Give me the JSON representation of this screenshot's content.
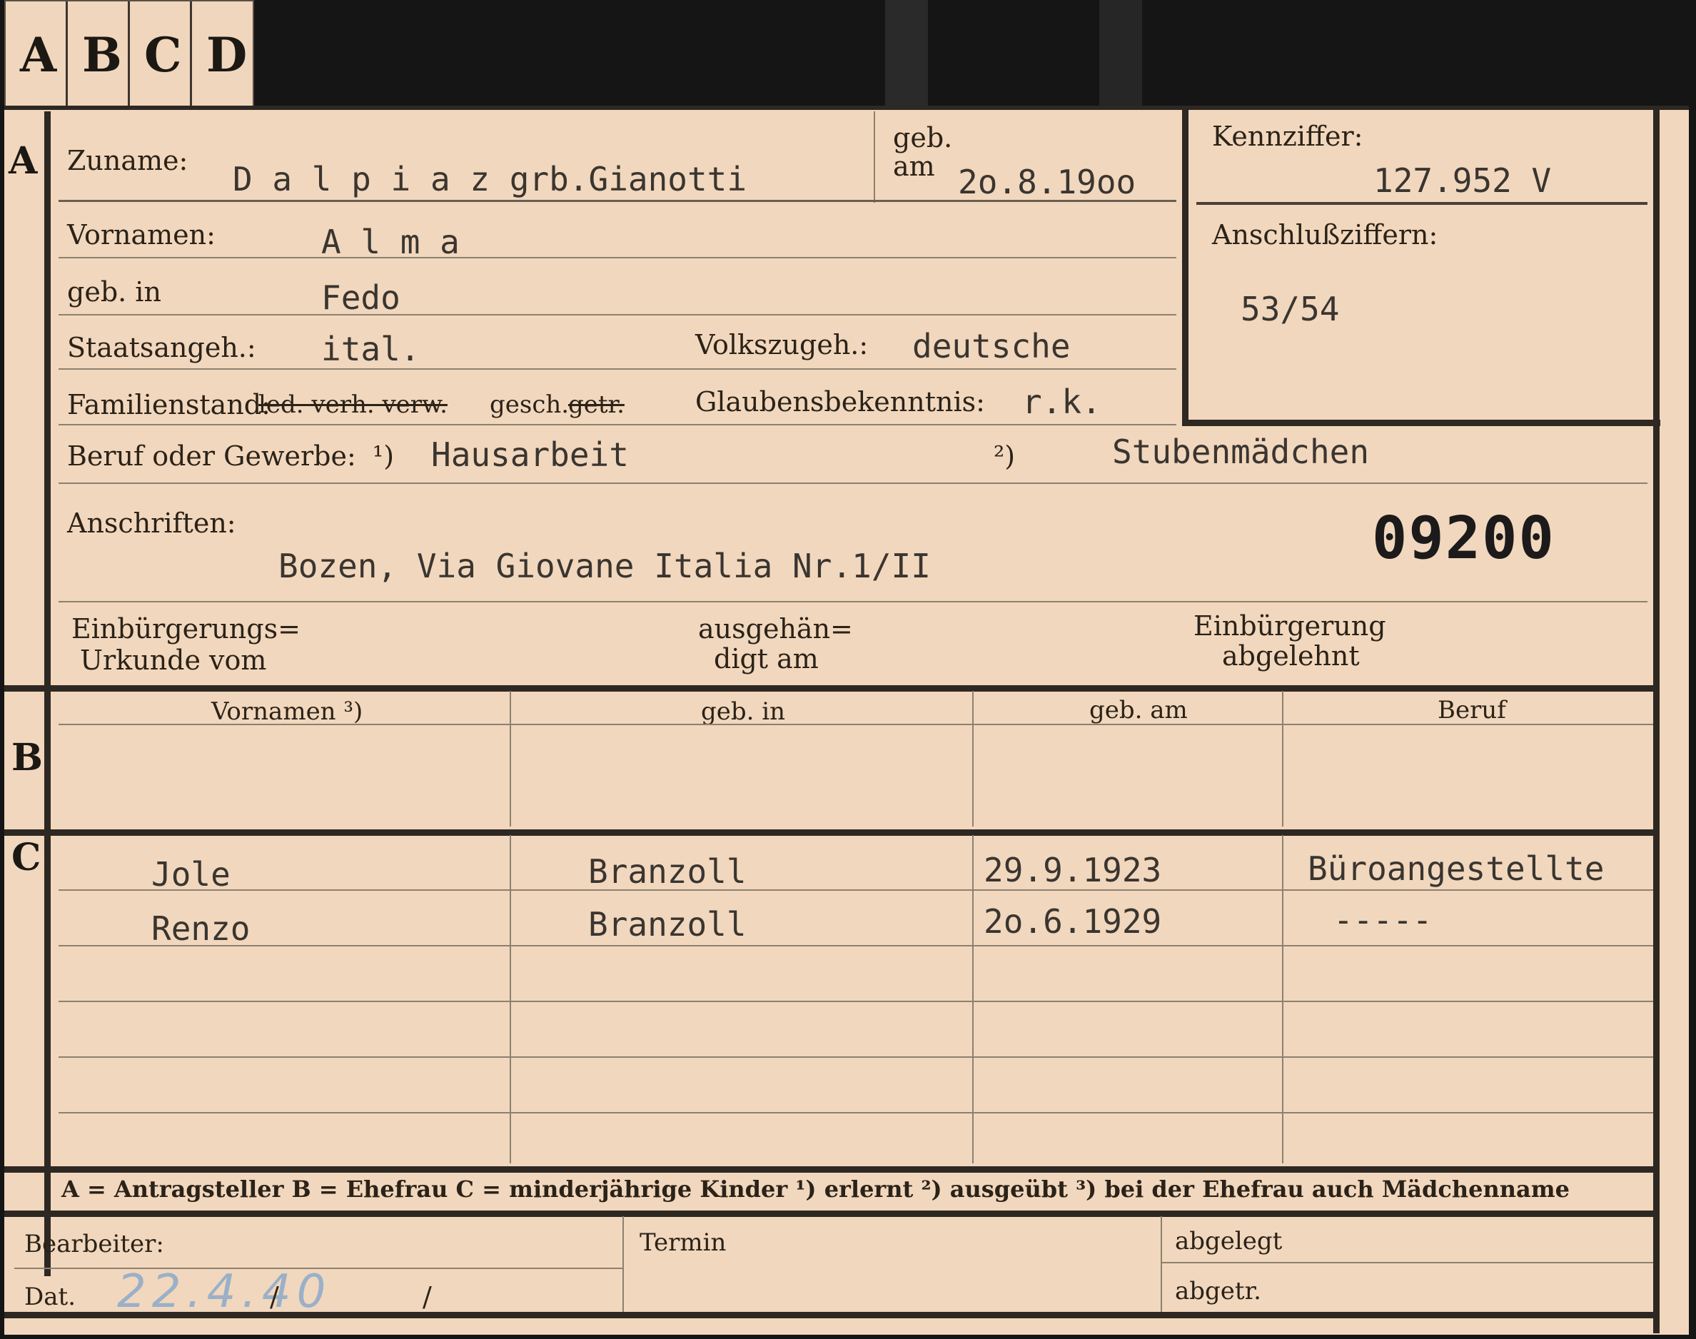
{
  "tabs": [
    "A",
    "B",
    "C",
    "D"
  ],
  "section_a": {
    "letter": "A",
    "zuname_label": "Zuname:",
    "zuname_value": "D a l p i a z   grb.Gianotti",
    "geb_am_label_1": "geb.",
    "geb_am_label_2": "am",
    "geb_am_value": "2o.8.19oo",
    "kennziffer_label": "Kennziffer:",
    "kennziffer_value": "127.952  V",
    "anschluss_label": "Anschlußziffern:",
    "anschluss_value": "53/54",
    "vornamen_label": "Vornamen:",
    "vornamen_value": "A l m a",
    "geb_in_label": "geb. in",
    "geb_in_value": "Fedo",
    "staatsangeh_label": "Staatsangeh.:",
    "staatsangeh_value": "ital.",
    "volkszugeh_label": "Volkszugeh.:",
    "volkszugeh_value": "deutsche",
    "familienstand_label": "Familienstand:",
    "familienstand_struck": "led. verh. verw.",
    "familienstand_kept": "gesch.",
    "familienstand_struck2": "getr.",
    "glaubens_label": "Glaubensbekenntnis:",
    "glaubens_value": "r.k.",
    "beruf_label": "Beruf oder Gewerbe:",
    "beruf_mark1": "¹)",
    "beruf_value1": "Hausarbeit",
    "beruf_mark2": "²)",
    "beruf_value2": "Stubenmädchen",
    "anschriften_label": "Anschriften:",
    "anschriften_value": "Bozen, Via Giovane Italia Nr.1/II",
    "stamp_number": "09200",
    "einb_urkunde_1": "Einbürgerungs=",
    "einb_urkunde_2": "Urkunde vom",
    "ausgehaendigt_1": "ausgehän=",
    "ausgehaendigt_2": "digt am",
    "einb_abgelehnt_1": "Einbürgerung",
    "einb_abgelehnt_2": "abgelehnt"
  },
  "section_b": {
    "letter": "B",
    "headers": [
      "Vornamen ³)",
      "geb. in",
      "geb. am",
      "Beruf"
    ]
  },
  "section_c": {
    "letter": "C",
    "rows": [
      {
        "vorname": "Jole",
        "geb_in": "Branzoll",
        "geb_am": "29.9.1923",
        "beruf": "Büroangestellte"
      },
      {
        "vorname": "Renzo",
        "geb_in": "Branzoll",
        "geb_am": "2o.6.1929",
        "beruf": "-----"
      }
    ]
  },
  "legend": "A = Antragsteller   B = Ehefrau   C = minderjährige Kinder   ¹) erlernt   ²) ausgeübt   ³) bei der Ehefrau auch Mädchenname",
  "footer": {
    "bearbeiter_label": "Bearbeiter:",
    "dat_label": "Dat.",
    "dat_value": "22.4.40",
    "dat_slash1": "/",
    "dat_slash2": "/",
    "termin_label": "Termin",
    "abgelegt_label": "abgelegt",
    "abgetr_label": "abgetr."
  },
  "colors": {
    "card": "#f1d7bd",
    "frame": "#2e2823",
    "background": "#151515",
    "pencil": "#9ab0c8"
  }
}
